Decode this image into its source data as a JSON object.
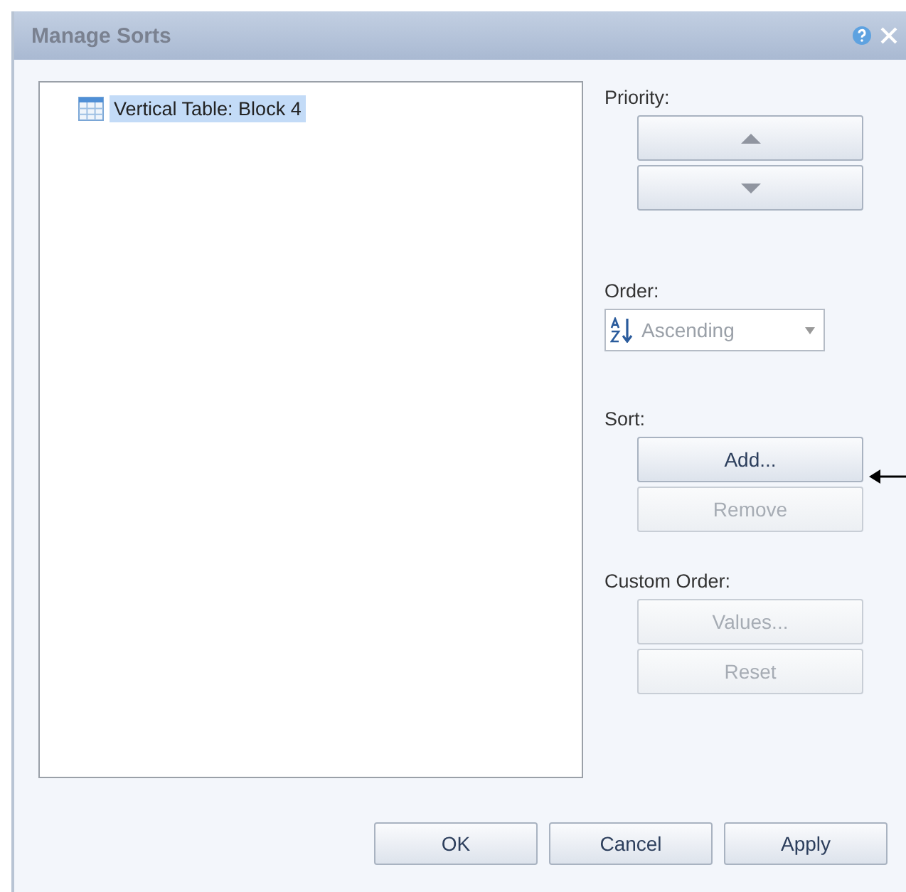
{
  "window": {
    "title": "Manage Sorts"
  },
  "tree": {
    "items": [
      {
        "label": "Vertical Table: Block 4",
        "selected": true
      }
    ]
  },
  "priority": {
    "label": "Priority:",
    "buttons": [
      {
        "kind": "up",
        "disabled": false
      },
      {
        "kind": "down",
        "disabled": false
      }
    ]
  },
  "order": {
    "label": "Order:",
    "value": "Ascending",
    "disabled": true
  },
  "sort": {
    "label": "Sort:",
    "buttons": [
      {
        "label": "Add...",
        "disabled": false
      },
      {
        "label": "Remove",
        "disabled": true
      }
    ]
  },
  "custom_order": {
    "label": "Custom Order:",
    "buttons": [
      {
        "label": "Values...",
        "disabled": true
      },
      {
        "label": "Reset",
        "disabled": true
      }
    ]
  },
  "footer_buttons": [
    {
      "label": "OK",
      "disabled": false
    },
    {
      "label": "Cancel",
      "disabled": false
    },
    {
      "label": "Apply",
      "disabled": false
    }
  ]
}
